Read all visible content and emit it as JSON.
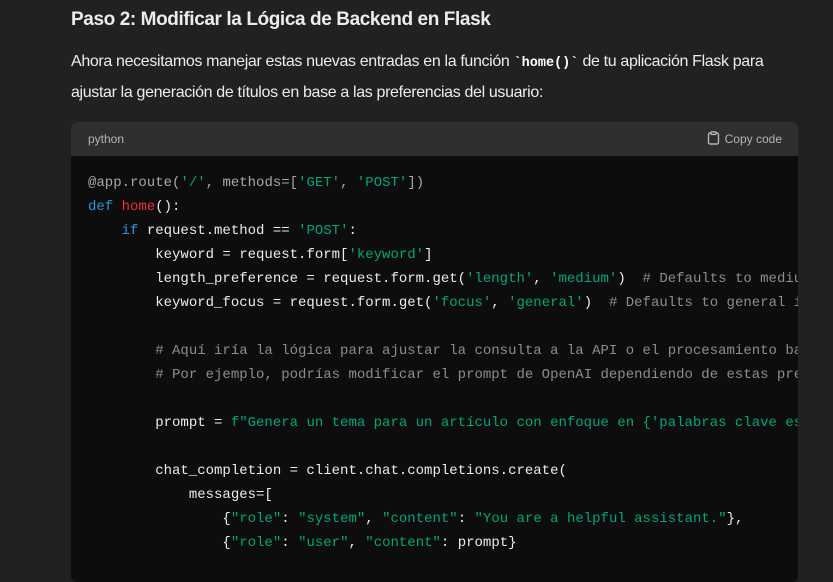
{
  "heading": "Paso 2: Modificar la Lógica de Backend en Flask",
  "paragraph": {
    "line1_before": "Ahora necesitamos manejar estas nuevas entradas en la función ",
    "inline_code": "`home()`",
    "line1_after": " de tu aplicación Flask para",
    "line2": "ajustar la generación de títulos en base a las preferencias del usuario:"
  },
  "code_block": {
    "language": "python",
    "copy_label": "Copy code",
    "copy_icon": "clipboard-icon",
    "colors": {
      "keyword": "#2e95d3",
      "function": "#f22c3d",
      "string": "#00a67d",
      "comment": "#8d8d8d"
    },
    "lines": [
      [
        [
          "@app.route(",
          "meta"
        ],
        [
          "'/'",
          "str"
        ],
        [
          ", methods=[",
          "meta"
        ],
        [
          "'GET'",
          "str"
        ],
        [
          ", ",
          "meta"
        ],
        [
          "'POST'",
          "str"
        ],
        [
          "])",
          "meta"
        ]
      ],
      [
        [
          "def",
          "kw"
        ],
        [
          " ",
          "pl"
        ],
        [
          "home",
          "fn"
        ],
        [
          "():",
          "pl"
        ]
      ],
      [
        [
          "    ",
          "pl"
        ],
        [
          "if",
          "kw"
        ],
        [
          " request.method == ",
          "pl"
        ],
        [
          "'POST'",
          "str"
        ],
        [
          ":",
          "pl"
        ]
      ],
      [
        [
          "        keyword = request.form[",
          "pl"
        ],
        [
          "'keyword'",
          "str"
        ],
        [
          "]",
          "pl"
        ]
      ],
      [
        [
          "        length_preference = request.form.get(",
          "pl"
        ],
        [
          "'length'",
          "str"
        ],
        [
          ", ",
          "pl"
        ],
        [
          "'medium'",
          "str"
        ],
        [
          ")  ",
          "pl"
        ],
        [
          "# Defaults to medium if not specified",
          "cm"
        ]
      ],
      [
        [
          "        keyword_focus = request.form.get(",
          "pl"
        ],
        [
          "'focus'",
          "str"
        ],
        [
          ", ",
          "pl"
        ],
        [
          "'general'",
          "str"
        ],
        [
          ")  ",
          "pl"
        ],
        [
          "# Defaults to general if not specified",
          "cm"
        ]
      ],
      [],
      [
        [
          "        ",
          "pl"
        ],
        [
          "# Aquí iría la lógica para ajustar la consulta a la API o el procesamiento basado en las preferencias",
          "cm"
        ]
      ],
      [
        [
          "        ",
          "pl"
        ],
        [
          "# Por ejemplo, podrías modificar el prompt de OpenAI dependiendo de estas preferencias",
          "cm"
        ]
      ],
      [],
      [
        [
          "        prompt = ",
          "pl"
        ],
        [
          "f\"Genera un tema para un artículo con enfoque en {'palabras clave es",
          "str"
        ]
      ],
      [],
      [
        [
          "        chat_completion = client.chat.completions.create(",
          "pl"
        ]
      ],
      [
        [
          "            messages=[",
          "pl"
        ]
      ],
      [
        [
          "                {",
          "pl"
        ],
        [
          "\"role\"",
          "str"
        ],
        [
          ": ",
          "pl"
        ],
        [
          "\"system\"",
          "str"
        ],
        [
          ", ",
          "pl"
        ],
        [
          "\"content\"",
          "str"
        ],
        [
          ": ",
          "pl"
        ],
        [
          "\"You are a helpful assistant.\"",
          "str"
        ],
        [
          "},",
          "pl"
        ]
      ],
      [
        [
          "                {",
          "pl"
        ],
        [
          "\"role\"",
          "str"
        ],
        [
          ": ",
          "pl"
        ],
        [
          "\"user\"",
          "str"
        ],
        [
          ", ",
          "pl"
        ],
        [
          "\"content\"",
          "str"
        ],
        [
          ": prompt}",
          "pl"
        ]
      ]
    ]
  }
}
